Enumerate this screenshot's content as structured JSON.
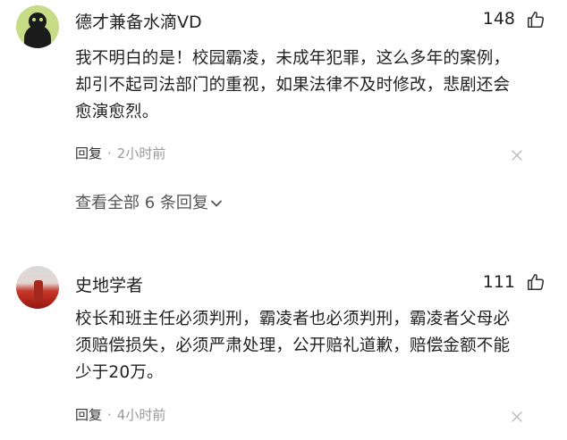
{
  "comments": [
    {
      "username": "德才兼备水滴VD",
      "like_count": "148",
      "text": "我不明白的是！校园霸凌，未成年犯罪，这么多年的案例，却引不起司法部门的重视，如果法律不及时修改，悲剧还会愈演愈烈。",
      "reply_label": "回复",
      "separator": "·",
      "time": "2小时前",
      "view_all_label": "查看全部 6 条回复"
    },
    {
      "username": "史地学者",
      "like_count": "111",
      "text": "校长和班主任必须判刑，霸凌者也必须判刑，霸凌者父母必须赔偿损失，必须严肃处理，公开赔礼道歉，赔偿金额不能少于20万。",
      "reply_label": "回复",
      "separator": "·",
      "time": "4小时前"
    }
  ],
  "icons": {
    "like": "thumbs-up-icon",
    "close": "close-icon",
    "expand": "chevron-down-icon"
  },
  "colors": {
    "text_primary": "#222222",
    "text_secondary": "#999999",
    "link": "#555555"
  }
}
